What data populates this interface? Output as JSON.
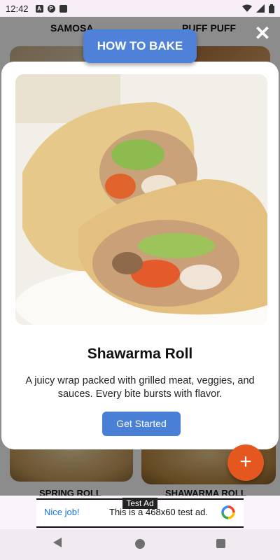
{
  "status_bar": {
    "time": "12:42"
  },
  "background_grid": {
    "top_titles": [
      "SAMOSA",
      "PUFF PUFF"
    ],
    "bottom_titles": [
      "SPRING ROLL",
      "SHAWARMA ROLL"
    ]
  },
  "header": {
    "how_to_bake_label": "HOW TO BAKE",
    "close_symbol": "✕"
  },
  "modal": {
    "title": "Shawarma Roll",
    "description": "A juicy wrap packed with grilled meat, veggies, and sauces. Every bite bursts with flavor.",
    "button_label": "Get Started"
  },
  "fab": {
    "symbol": "+"
  },
  "ad": {
    "tag": "Test Ad",
    "nice_job": "Nice job!",
    "text": "This is a 468x60 test ad."
  },
  "colors": {
    "primary_blue": "#4f81d8",
    "fab_orange": "#e4571f",
    "ad_link_blue": "#1a73e8"
  }
}
